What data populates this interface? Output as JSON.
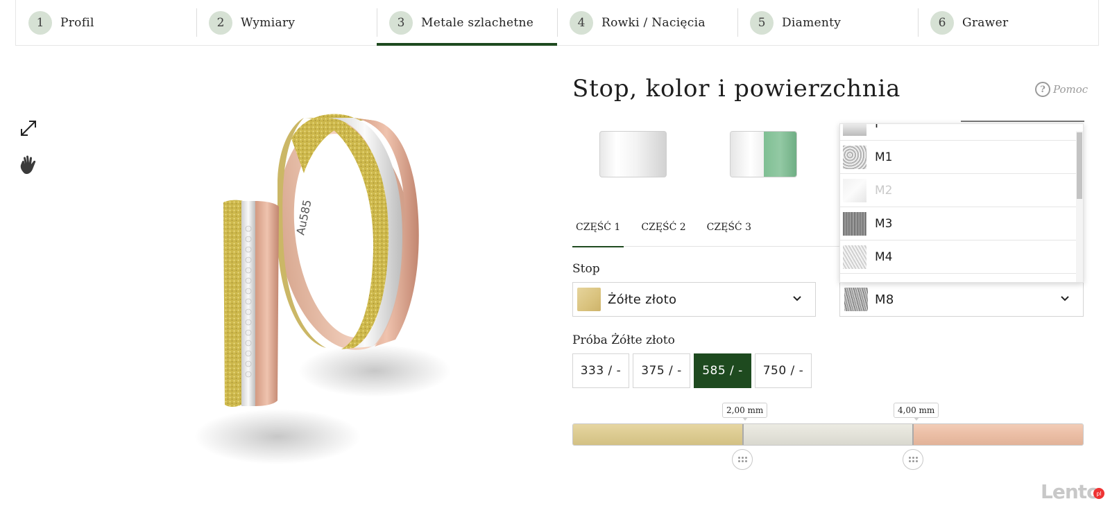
{
  "stepper": [
    {
      "num": "1",
      "label": "Profil",
      "active": false
    },
    {
      "num": "2",
      "label": "Wymiary",
      "active": false
    },
    {
      "num": "3",
      "label": "Metale szlachetne",
      "active": true
    },
    {
      "num": "4",
      "label": "Rowki / Nacięcia",
      "active": false
    },
    {
      "num": "5",
      "label": "Diamenty",
      "active": false
    },
    {
      "num": "6",
      "label": "Grawer",
      "active": false
    }
  ],
  "viewer": {
    "tools": [
      "expand-icon",
      "hand-icon"
    ],
    "engraving": "Au585"
  },
  "panel": {
    "title": "Stop, kolor i powierzchnia",
    "help_label": "Pomoc",
    "tabs": [
      "CZĘŚĆ 1",
      "CZĘŚĆ 2",
      "CZĘŚĆ 3"
    ],
    "active_tab": 0,
    "alloy_label": "Stop",
    "alloy_value": "Żółte złoto",
    "surface_value": "M8",
    "proba_label": "Próba Żółte złoto",
    "proba_options": [
      "333 / -",
      "375 / -",
      "585 / -",
      "750 / -"
    ],
    "proba_selected": "585 / -",
    "slider": {
      "markers": [
        "2,00 mm",
        "4,00 mm"
      ],
      "segment_colors": [
        "#dccb91",
        "#e3e2d9",
        "#ebbea5"
      ]
    },
    "surface_dropdown": [
      {
        "label": "P",
        "disabled": false,
        "texture": "tx-p"
      },
      {
        "label": "M1",
        "disabled": false,
        "texture": "tx-m1"
      },
      {
        "label": "M2",
        "disabled": true,
        "texture": "tx-m2"
      },
      {
        "label": "M3",
        "disabled": false,
        "texture": "tx-m3"
      },
      {
        "label": "M4",
        "disabled": false,
        "texture": "tx-m4"
      }
    ]
  },
  "watermark": "Lento",
  "colors": {
    "accent": "#1e4a1f",
    "step_circle": "#d6e1d4"
  }
}
